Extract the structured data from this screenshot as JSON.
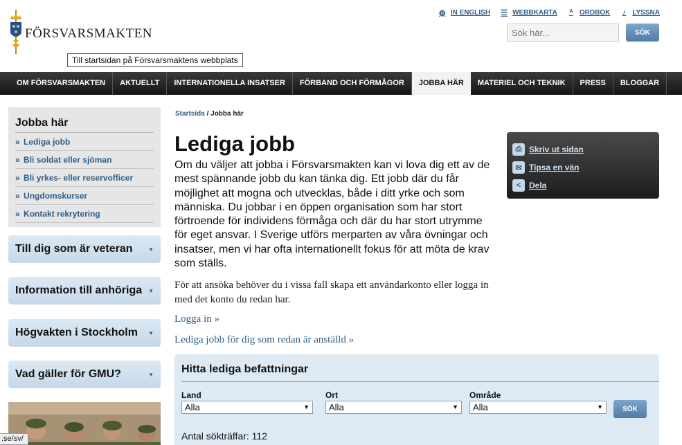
{
  "brand": {
    "name": "FÖRSVARSMAKTEN",
    "tooltip": "Till startsidan på Försvarsmaktens webbplats"
  },
  "toplinks": [
    {
      "label": "IN ENGLISH",
      "icon": "globe-icon"
    },
    {
      "label": "WEBBKARTA",
      "icon": "sitemap-icon"
    },
    {
      "label": "ORDBOK",
      "icon": "dictionary-icon"
    },
    {
      "label": "LYSSNA",
      "icon": "listen-icon"
    }
  ],
  "search": {
    "placeholder": "Sök här...",
    "button": "SÖK"
  },
  "nav": [
    {
      "label": "OM FÖRSVARSMAKTEN",
      "active": false
    },
    {
      "label": "AKTUELLT",
      "active": false
    },
    {
      "label": "INTERNATIONELLA INSATSER",
      "active": false
    },
    {
      "label": "FÖRBAND OCH FÖRMÅGOR",
      "active": false
    },
    {
      "label": "JOBBA HÄR",
      "active": true
    },
    {
      "label": "MATERIEL OCH TEKNIK",
      "active": false
    },
    {
      "label": "PRESS",
      "active": false
    },
    {
      "label": "BLOGGAR",
      "active": false
    }
  ],
  "sidebar": {
    "title": "Jobba här",
    "items": [
      {
        "label": "Lediga jobb"
      },
      {
        "label": "Bli soldat eller sjöman"
      },
      {
        "label": "Bli yrkes- eller reservofficer"
      },
      {
        "label": "Ungdomskurser"
      },
      {
        "label": "Kontakt rekrytering"
      }
    ],
    "accordions": [
      {
        "label": "Till dig som är veteran"
      },
      {
        "label": "Information till anhöriga"
      },
      {
        "label": "Högvakten i Stockholm"
      },
      {
        "label": "Vad gäller för GMU?"
      }
    ]
  },
  "breadcrumb": {
    "home": "Startsida",
    "separator": "/",
    "current": "Jobba här"
  },
  "main": {
    "title": "Lediga jobb",
    "intro": "Om du väljer att jobba i Försvarsmakten kan vi lova dig ett av de mest spännande jobb du kan tänka dig. Ett jobb där du får möjlighet att mogna och utvecklas, både i ditt yrke och som människa. Du jobbar i en öppen organisation som har stort förtroende för individens förmåga och där du har stort utrymme för eget ansvar. I Sverige utförs merparten av våra övningar och insatser, men vi har ofta internationellt fokus för att möta de krav som ställs.",
    "paragraph": "För att ansöka behöver du i vissa fall skapa ett användarkonto eller logga in med det konto du redan har.",
    "login_link": "Logga in »",
    "employed_link": "Lediga jobb för dig som redan är anställd »"
  },
  "tools": [
    {
      "label": "Skriv ut sidan",
      "icon": "print-icon"
    },
    {
      "label": "Tipsa en vän",
      "icon": "email-icon"
    },
    {
      "label": "Dela",
      "icon": "share-icon"
    }
  ],
  "jobsearch": {
    "title": "Hitta lediga befattningar",
    "fields": [
      {
        "label": "Land",
        "value": "Alla"
      },
      {
        "label": "Ort",
        "value": "Alla"
      },
      {
        "label": "Område",
        "value": "Alla"
      }
    ],
    "button": "SÖK",
    "count": "Antal sökträffar: 112"
  },
  "statusbar": ".se/sv/"
}
